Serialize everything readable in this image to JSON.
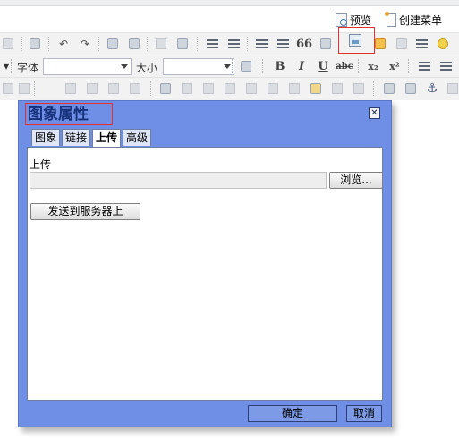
{
  "top_actions": {
    "preview_label": "预览",
    "create_menu_label": "创建菜单"
  },
  "toolbar": {
    "font_label": "字体",
    "size_label": "大小",
    "bold": "B",
    "italic": "I",
    "underline": "U",
    "strike": "abc",
    "subscript": "x₂",
    "superscript": "x²",
    "quote": "66"
  },
  "dialog": {
    "title": "图象属性",
    "close_symbol": "✕",
    "tabs": [
      {
        "label": "图象"
      },
      {
        "label": "链接"
      },
      {
        "label": "上传"
      },
      {
        "label": "高级"
      }
    ],
    "active_tab": "上传",
    "upload_label": "上传",
    "browse_label": "浏览...",
    "send_label": "发送到服务器上",
    "ok_label": "确定",
    "cancel_label": "取消"
  },
  "colors": {
    "dialog_bg": "#6f8fe6",
    "title_text": "#17307a",
    "highlight": "#e53030"
  }
}
